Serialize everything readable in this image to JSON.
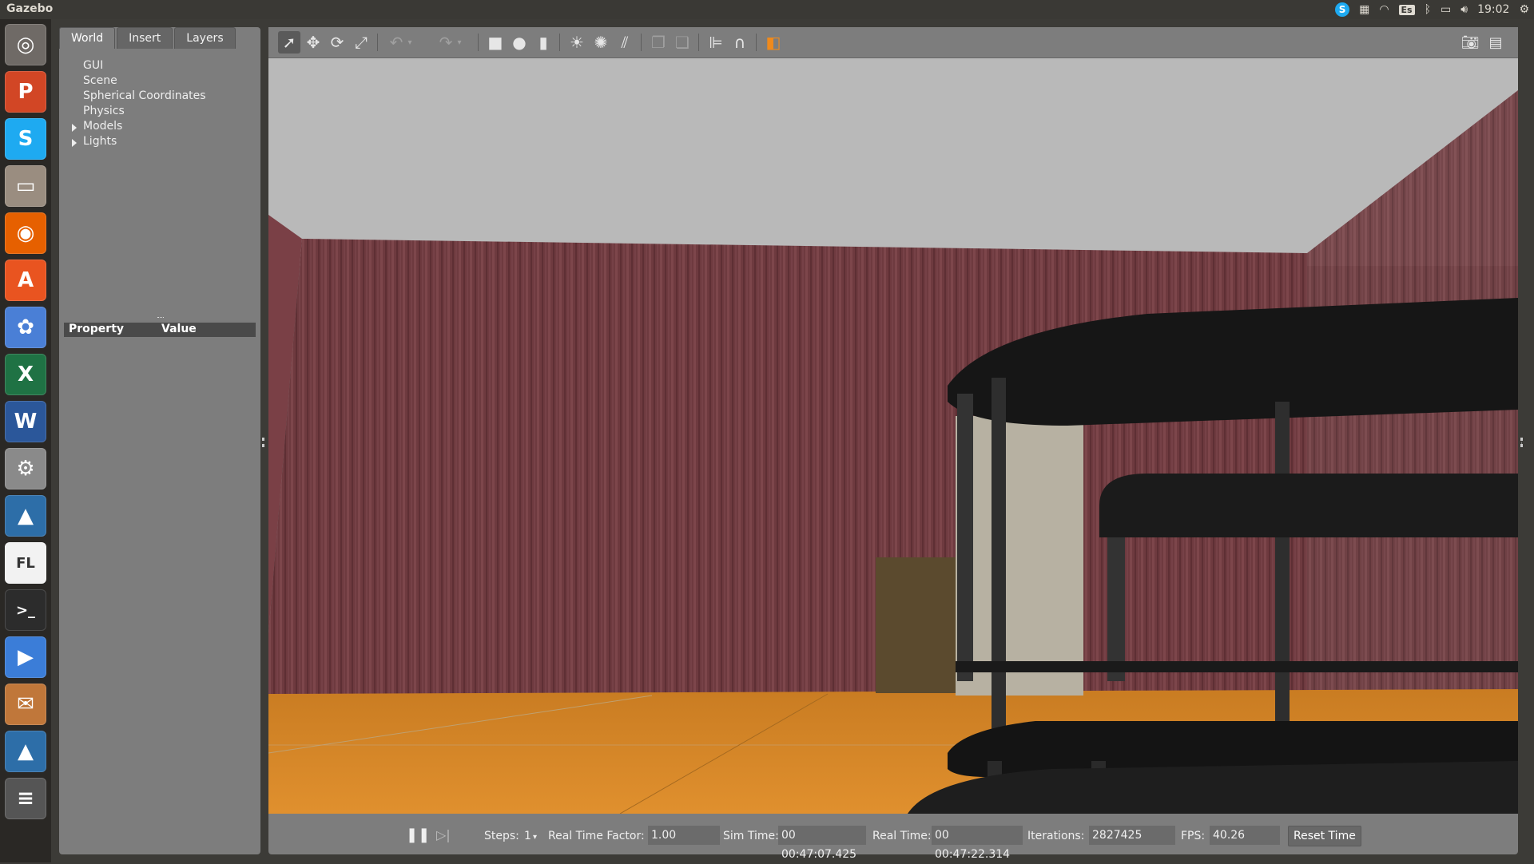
{
  "topbar": {
    "app_title": "Gazebo",
    "keyboard_layout": "Es",
    "clock": "19:02",
    "skype_letter": "S"
  },
  "launcher": {
    "items": [
      {
        "name": "ubuntu-dash",
        "glyph": "◎",
        "color": "#6f6a66"
      },
      {
        "name": "powerpoint",
        "glyph": "P",
        "color": "#d24625"
      },
      {
        "name": "skype",
        "glyph": "S",
        "color": "#1eaaf1"
      },
      {
        "name": "files",
        "glyph": "▭",
        "color": "#9a8d80"
      },
      {
        "name": "firefox",
        "glyph": "◉",
        "color": "#e66000"
      },
      {
        "name": "software-center",
        "glyph": "A",
        "color": "#e95420"
      },
      {
        "name": "picasa",
        "glyph": "✿",
        "color": "#4a7fd6"
      },
      {
        "name": "excel",
        "glyph": "X",
        "color": "#1f7244"
      },
      {
        "name": "word",
        "glyph": "W",
        "color": "#2b579a"
      },
      {
        "name": "system-settings",
        "glyph": "⚙",
        "color": "#8a8a8a"
      },
      {
        "name": "matlab",
        "glyph": "▲",
        "color": "#2d6ea8"
      },
      {
        "name": "flpsed",
        "glyph": "FL",
        "color": "#f2f2f2"
      },
      {
        "name": "terminal",
        "glyph": ">_",
        "color": "#2c2c2c"
      },
      {
        "name": "video-player",
        "glyph": "▶",
        "color": "#3b7dd8"
      },
      {
        "name": "package-installer",
        "glyph": "✉",
        "color": "#c0773a"
      },
      {
        "name": "matlab-2",
        "glyph": "▲",
        "color": "#2d6ea8"
      },
      {
        "name": "workspaces",
        "glyph": "≡",
        "color": "#555"
      }
    ]
  },
  "left_panel": {
    "tabs": [
      "World",
      "Insert",
      "Layers"
    ],
    "tree": [
      {
        "label": "GUI",
        "expandable": false
      },
      {
        "label": "Scene",
        "expandable": false
      },
      {
        "label": "Spherical Coordinates",
        "expandable": false
      },
      {
        "label": "Physics",
        "expandable": false
      },
      {
        "label": "Models",
        "expandable": true
      },
      {
        "label": "Lights",
        "expandable": true
      }
    ],
    "property_header": {
      "property": "Property",
      "value": "Value"
    }
  },
  "toolbar": {
    "icons": [
      "select-arrow-icon",
      "translate-icon",
      "rotate-icon",
      "scale-icon",
      "undo-icon",
      "undo-dropdown-icon",
      "redo-icon",
      "redo-dropdown-icon",
      "box-icon",
      "sphere-icon",
      "cylinder-icon",
      "point-light-icon",
      "spot-light-icon",
      "directional-light-icon",
      "copy-icon",
      "paste-icon",
      "align-icon",
      "snap-icon",
      "view-angle-icon",
      "screenshot-icon",
      "log-icon"
    ]
  },
  "status": {
    "steps_label": "Steps:",
    "steps_value": "1",
    "rtf_label": "Real Time Factor:",
    "rtf_value": "1.00",
    "sim_time_label": "Sim Time:",
    "sim_time_value": "00 00:47:07.425",
    "real_time_label": "Real Time:",
    "real_time_value": "00 00:47:22.314",
    "iterations_label": "Iterations:",
    "iterations_value": "2827425",
    "fps_label": "FPS:",
    "fps_value": "40.26",
    "reset_label": "Reset Time"
  },
  "colors": {
    "panel_bg": "#7d7d7d",
    "ceiling": "#b9b9b9",
    "wall": "#6e3a3f",
    "floor": "#d88a2c",
    "robot": "#1b1b1b"
  }
}
